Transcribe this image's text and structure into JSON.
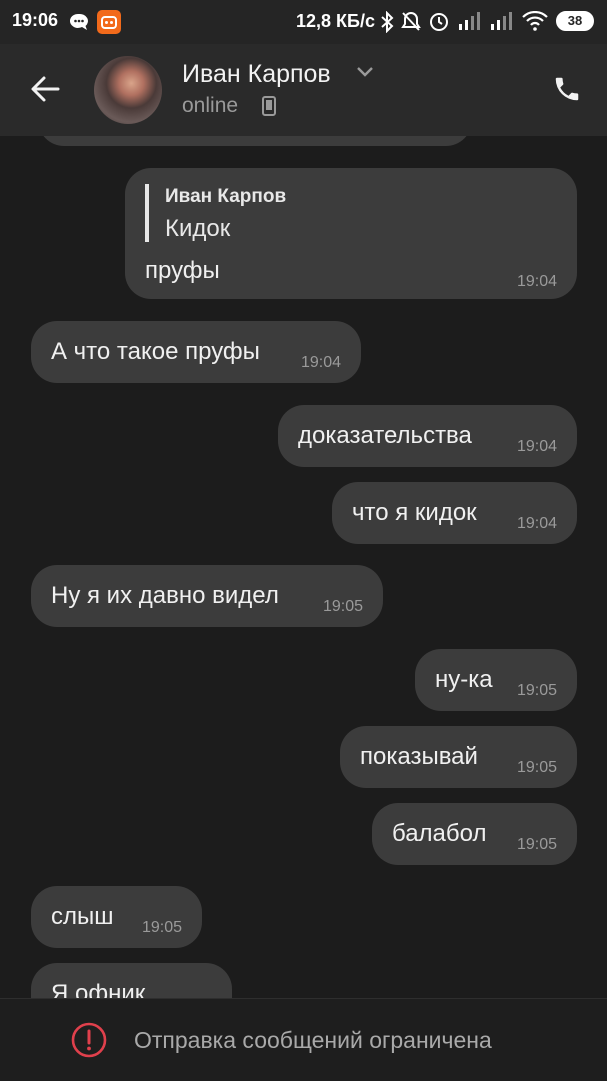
{
  "status_bar": {
    "time": "19:06",
    "speed": "12,8 КБ/с",
    "battery": "38",
    "icons": [
      "chat-bubble-icon",
      "app-notification-icon",
      "bluetooth-icon",
      "mute-icon",
      "alarm-icon",
      "signal-icon",
      "signal-icon",
      "wifi-icon",
      "battery-icon"
    ]
  },
  "header": {
    "name": "Иван Карпов",
    "status": "online",
    "icons": [
      "back-arrow-icon",
      "chevron-down-icon",
      "phone-device-icon",
      "call-icon"
    ]
  },
  "messages": [
    {
      "side": "out",
      "reply_to_name": "Иван Карпов",
      "reply_to_text": "Кидок",
      "text": "пруфы",
      "time": "19:04"
    },
    {
      "side": "in",
      "text": "А что такое пруфы",
      "time": "19:04"
    },
    {
      "side": "out",
      "text": "доказательства",
      "time": "19:04"
    },
    {
      "side": "out",
      "text": "что я кидок",
      "time": "19:04"
    },
    {
      "side": "in",
      "text": "Ну я их давно видел",
      "time": "19:05"
    },
    {
      "side": "out",
      "text": "ну-ка",
      "time": "19:05"
    },
    {
      "side": "out",
      "text": "показывай",
      "time": "19:05"
    },
    {
      "side": "out",
      "text": "балабол",
      "time": "19:05"
    },
    {
      "side": "in",
      "text": "слыш",
      "time": "19:05"
    },
    {
      "side": "in",
      "text": "Я офник",
      "time": ""
    }
  ],
  "footer": {
    "notice": "Отправка сообщений ограничена",
    "icon": "warning-circle-icon",
    "accent_color": "#e0404c"
  }
}
